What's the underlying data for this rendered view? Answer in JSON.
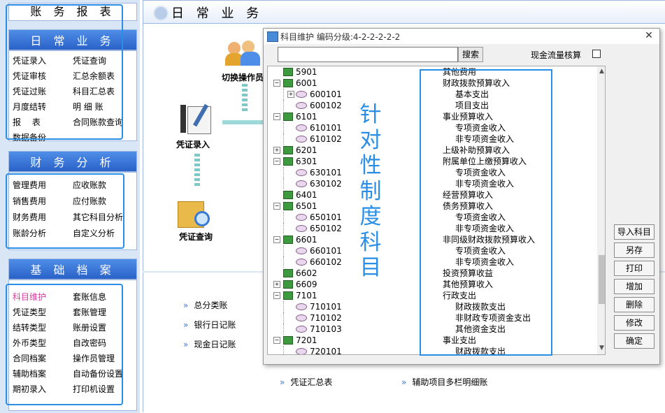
{
  "left_nav": {
    "top_title": "账 务 报 表",
    "section1": {
      "title": "日 常 业 务",
      "items": [
        "凭证录入",
        "凭证查询",
        "凭证审核",
        "汇总余额表",
        "凭证过账",
        "科目汇总表",
        "月度结转",
        "明 细 账",
        "报　 表",
        "合同账款查询",
        "数据备份"
      ]
    },
    "section2": {
      "title": "财 务 分 析",
      "items": [
        "管理费用",
        "应收账款",
        "销售费用",
        "应付账款",
        "财务费用",
        "其它科目分析",
        "账龄分析",
        "自定义分析"
      ]
    },
    "section3": {
      "title": "基 础 档 案",
      "items": [
        "科目维护",
        "套账信息",
        "凭证类型",
        "套账管理",
        "结转类型",
        "账册设置",
        "外币类型",
        "自改密码",
        "合同档案",
        "操作员管理",
        "辅助档案",
        "自动备份设置",
        "期初录入",
        "打印机设置"
      ]
    },
    "colors": {
      "accent": "#2a62c8",
      "highlight_outline": "#2a8ee6",
      "active_item": "#d63ea0"
    }
  },
  "main": {
    "header_title": "日 常 业 务",
    "flow": {
      "switch_label": "切换操作员",
      "voucher_entry": "凭证录入",
      "voucher_query": "凭证查询"
    },
    "links": [
      "总分类账",
      "银行日记账",
      "现金日记账",
      "凭证汇总表",
      "辅助项目多栏明细账"
    ]
  },
  "dialog": {
    "title": "科目维护  编码分级:4-2-2-2-2-2",
    "close": "✕",
    "search_placeholder": "",
    "search_button": "搜索",
    "cash_flow_label": "现金流量核算",
    "buttons": [
      "导入科目",
      "另存",
      "打印",
      "增加",
      "删除",
      "修改",
      "确定"
    ],
    "overlay_text": [
      "针",
      "对",
      "性",
      "制",
      "度",
      "科",
      "目"
    ],
    "tree": [
      {
        "code": "5901",
        "name": "其他费用",
        "level": 0,
        "expander": "none"
      },
      {
        "code": "6001",
        "name": "财政拨款预算收入",
        "level": 0,
        "expander": "minus"
      },
      {
        "code": "600101",
        "name": "基本支出",
        "level": 1,
        "expander": "plus"
      },
      {
        "code": "600102",
        "name": "项目支出",
        "level": 1,
        "expander": "none"
      },
      {
        "code": "6101",
        "name": "事业预算收入",
        "level": 0,
        "expander": "minus"
      },
      {
        "code": "610101",
        "name": "专项资金收入",
        "level": 1,
        "expander": "none"
      },
      {
        "code": "610102",
        "name": "非专项资金收入",
        "level": 1,
        "expander": "none"
      },
      {
        "code": "6201",
        "name": "上级补助预算收入",
        "level": 0,
        "expander": "plus"
      },
      {
        "code": "6301",
        "name": "附属单位上缴预算收入",
        "level": 0,
        "expander": "minus"
      },
      {
        "code": "630101",
        "name": "专项资金收入",
        "level": 1,
        "expander": "none"
      },
      {
        "code": "630102",
        "name": "非专项资金收入",
        "level": 1,
        "expander": "none"
      },
      {
        "code": "6401",
        "name": "经营预算收入",
        "level": 0,
        "expander": "none"
      },
      {
        "code": "6501",
        "name": "债务预算收入",
        "level": 0,
        "expander": "minus"
      },
      {
        "code": "650101",
        "name": "专项资金收入",
        "level": 1,
        "expander": "none"
      },
      {
        "code": "650102",
        "name": "非专项资金收入",
        "level": 1,
        "expander": "none"
      },
      {
        "code": "6601",
        "name": "非同级财政拨款预算收入",
        "level": 0,
        "expander": "minus"
      },
      {
        "code": "660101",
        "name": "专项资金收入",
        "level": 1,
        "expander": "none"
      },
      {
        "code": "660102",
        "name": "非专项资金收入",
        "level": 1,
        "expander": "none"
      },
      {
        "code": "6602",
        "name": "投资预算收益",
        "level": 0,
        "expander": "none"
      },
      {
        "code": "6609",
        "name": "其他预算收入",
        "level": 0,
        "expander": "plus"
      },
      {
        "code": "7101",
        "name": "行政支出",
        "level": 0,
        "expander": "minus"
      },
      {
        "code": "710101",
        "name": "财政拨款支出",
        "level": 1,
        "expander": "none"
      },
      {
        "code": "710102",
        "name": "非财政专项资金支出",
        "level": 1,
        "expander": "none"
      },
      {
        "code": "710103",
        "name": "其他资金支出",
        "level": 1,
        "expander": "none"
      },
      {
        "code": "7201",
        "name": "事业支出",
        "level": 0,
        "expander": "minus"
      },
      {
        "code": "720101",
        "name": "财政拨款支出",
        "level": 1,
        "expander": "none"
      }
    ]
  }
}
